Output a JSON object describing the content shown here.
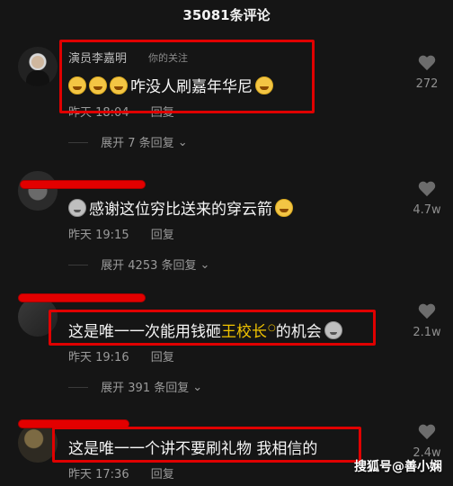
{
  "header": {
    "title": "35081条评论"
  },
  "comments": [
    {
      "username": "演员李嘉明",
      "tag": "你的关注",
      "text": "咋没人刷嘉年华尼",
      "time": "昨天 18:04",
      "reply_label": "回复",
      "expand_label": "展开 7 条回复",
      "likes": "272"
    },
    {
      "text": "感谢这位穷比送来的穿云箭",
      "time": "昨天 19:15",
      "reply_label": "回复",
      "expand_label": "展开 4253 条回复",
      "likes": "4.7w"
    },
    {
      "text_prefix": "这是唯一一次能用钱砸",
      "highlight": "王校长",
      "text_suffix": "的机会",
      "time": "昨天 19:16",
      "reply_label": "回复",
      "expand_label": "展开 391 条回复",
      "likes": "2.1w"
    },
    {
      "text": "这是唯一一个讲不要刷礼物 我相信的",
      "time": "昨天 17:36",
      "reply_label": "回复",
      "likes": "2.4w"
    }
  ],
  "watermark": "搜狐号@善小娴",
  "icons": {
    "like": "heart-icon",
    "chevron": "chevron-down-icon",
    "search": "search-icon",
    "emoji": "laughing-tears-emoji-icon",
    "cat": "cat-emoji-icon"
  },
  "colors": {
    "background": "#151515",
    "redact": "#e30000",
    "annotation_box": "#e00000",
    "highlight": "#f2c400"
  }
}
